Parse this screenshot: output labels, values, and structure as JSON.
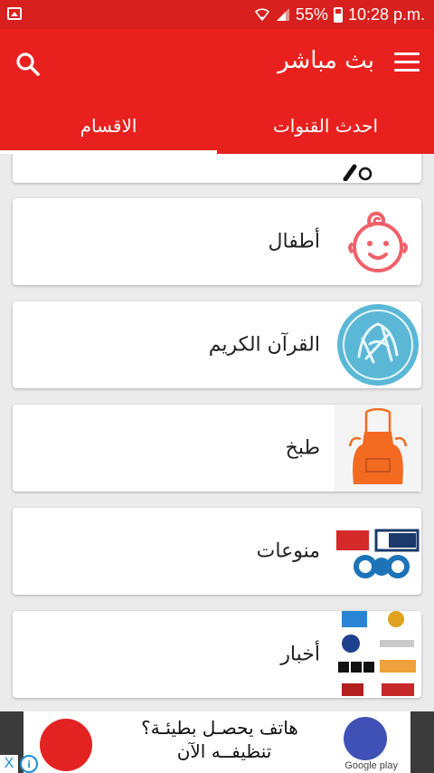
{
  "status_bar": {
    "battery": "55%",
    "time": "10:28 p.m."
  },
  "toolbar": {
    "title": "بث مباشر"
  },
  "tabs": [
    {
      "label": "احدث القنوات",
      "selected": false
    },
    {
      "label": "الاقسام",
      "selected": true
    }
  ],
  "categories": [
    {
      "label": "",
      "icon": "sports-icon"
    },
    {
      "label": "أطفال",
      "icon": "baby-face-icon"
    },
    {
      "label": "القرآن الكريم",
      "icon": "quran-calligraphy-icon"
    },
    {
      "label": "طبخ",
      "icon": "apron-icon"
    },
    {
      "label": "منوعات",
      "icon": "variety-channels-logos"
    },
    {
      "label": "أخبار",
      "icon": "news-channels-logos"
    }
  ],
  "ad": {
    "line1": "هاتف يحصـل بطيئـة؟",
    "line2": "تنظيفــه الآن",
    "store": "Google play",
    "close": "X",
    "info": "i"
  },
  "colors": {
    "primary": "#e8211f",
    "status_bar": "#d8201e",
    "background": "#ebebeb",
    "baby_icon": "#f0606a",
    "apron": "#f26b21",
    "quran_icon": "#5ab8d6"
  }
}
